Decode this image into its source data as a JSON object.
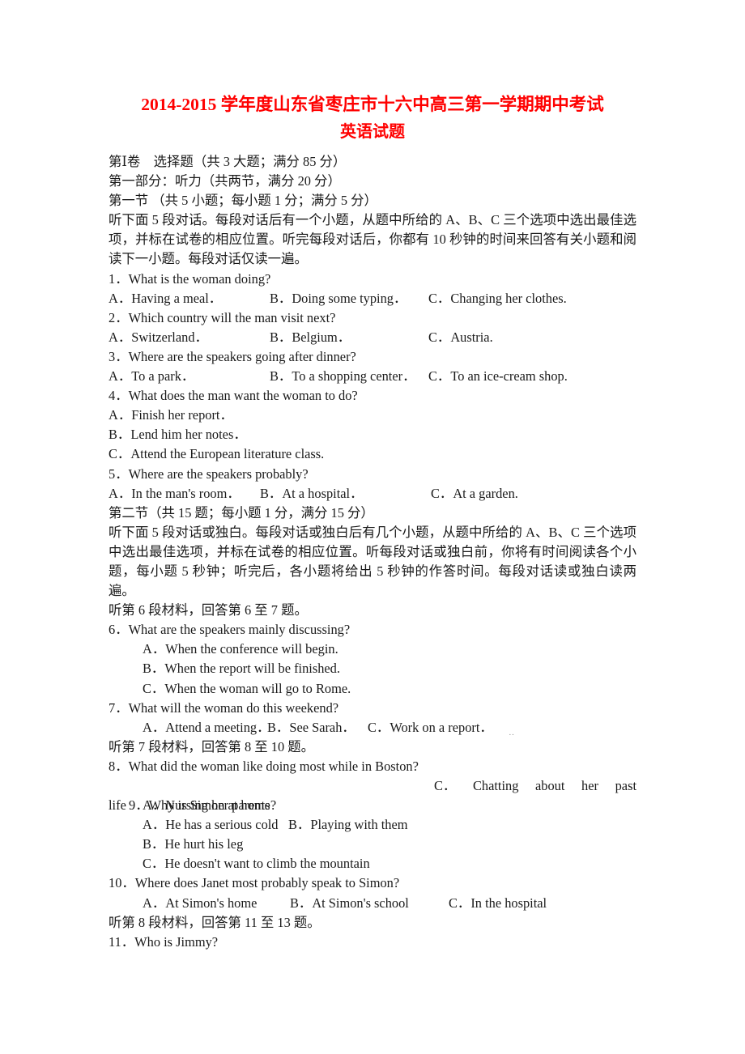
{
  "document": {
    "title": "2014-2015 学年度山东省枣庄市十六中高三第一学期期中考试",
    "subtitle": "英语试题"
  },
  "sections": {
    "paper_part_line": "第Ⅰ卷　选择题（共 3 大题；满分 85 分）",
    "part_one_line": "第一部分：听力（共两节，满分 20 分）",
    "section_one_header": "第一节 （共 5 小题；每小题 1 分；满分 5 分）",
    "section_one_instruction": "听下面 5 段对话。每段对话后有一个小题，从题中所给的 A、B、C 三个选项中选出最佳选项，并标在试卷的相应位置。听完每段对话后，你都有 10 秒钟的时间来回答有关小题和阅读下一小题。每段对话仅读一遍。",
    "section_two_header": "第二节（共 15 题；每小题 1 分，满分 15 分）",
    "section_two_instruction": "听下面 5 段对话或独白。每段对话或独白后有几个小题，从题中所给的 A、B、C 三个选项中选出最佳选项，并标在试卷的相应位置。听每段对话或独白前，你将有时间阅读各个小题，每小题 5 秒钟；听完后，各小题将给出 5 秒钟的作答时间。每段对话读或独白读两遍。",
    "material_6": "听第 6 段材料，回答第 6 至 7 题。",
    "material_7": "听第 7 段材料，回答第 8 至 10 题。",
    "material_8": "听第 8 段材料，回答第 11 至 13 题。"
  },
  "questions": {
    "q1": {
      "stem": "1．What is the woman doing?",
      "a": "A．Having a meal．",
      "b": "B．Doing some typing．",
      "c": "C．Changing her clothes."
    },
    "q2": {
      "stem": "2．Which country will the man visit next?",
      "a": "A．Switzerland．",
      "b": "B．Belgium．",
      "c": "C．Austria."
    },
    "q3": {
      "stem": "3．Where are the speakers going after dinner?",
      "a": "A．To a park．",
      "b": "B．To a shopping center．",
      "c": "C．To an ice-cream shop."
    },
    "q4": {
      "stem": "4．What does the man want the woman to do?",
      "a": "A．Finish her report．",
      "b": "B．Lend him her notes．",
      "c": "C．Attend the European literature class."
    },
    "q5": {
      "stem": "5．Where are the speakers probably?",
      "a": "A．In the man's room．",
      "b": "B．At a hospital．",
      "c": "C．At a garden."
    },
    "q6": {
      "stem": "6．What are the speakers mainly discussing?",
      "a": "A．When the conference will begin.",
      "b": "B．When the report will be finished.",
      "c": "C．When the woman will go to Rome."
    },
    "q7": {
      "stem": "7．What will the woman do this weekend?",
      "a": "A．Attend a meeting．",
      "b": "B．See Sarah．",
      "c": "C．Work on a report．"
    },
    "q8": {
      "stem": "8．What did the woman like doing most while in Boston?",
      "a": "A．Nursing her parents",
      "b": "B．Playing with them",
      "c_label": "C．",
      "c_w1": "Chatting",
      "c_w2": "about",
      "c_w3": "her",
      "c_w4": "past",
      "c_tail": "life"
    },
    "q9": {
      "stem": "9．Why is Simon at home?",
      "a": "A．He has a serious cold",
      "b": "B．He hurt his leg",
      "c": "C．He doesn't want to climb the mountain"
    },
    "q10": {
      "stem": "10．Where does Janet most probably speak to Simon?",
      "a": "A．At Simon's home",
      "b": "B．At Simon's school",
      "c": "C．In the hospital"
    },
    "q11": {
      "stem": "11．Who is Jimmy?"
    }
  },
  "style": {
    "title_color": "#FF0000",
    "body_color": "#1a1a1a"
  }
}
